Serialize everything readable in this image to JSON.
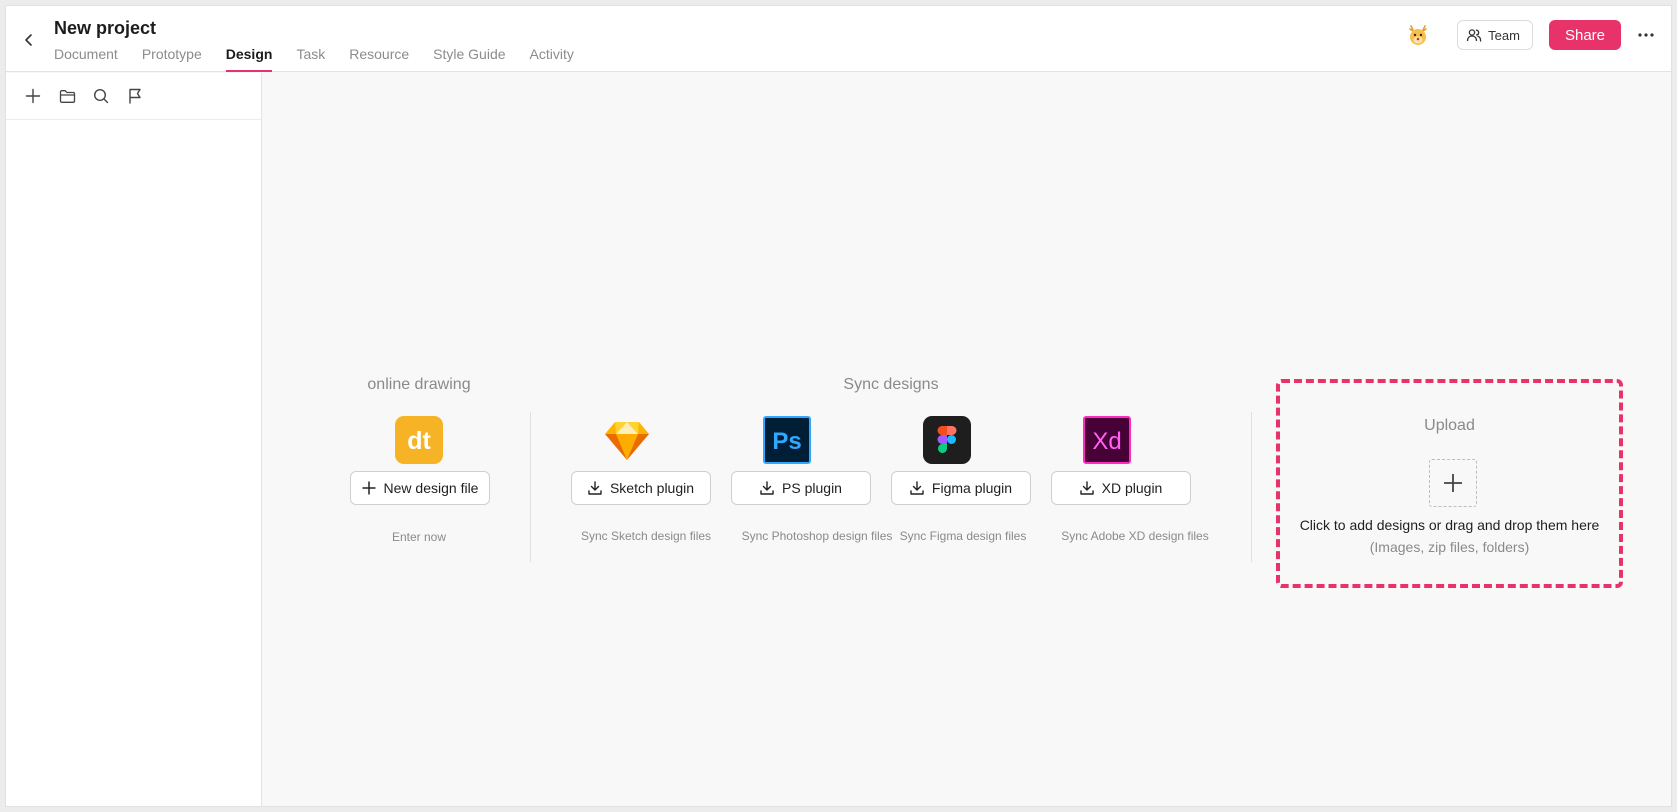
{
  "project": {
    "title": "New project"
  },
  "tabs": [
    {
      "label": "Document"
    },
    {
      "label": "Prototype"
    },
    {
      "label": "Design"
    },
    {
      "label": "Task"
    },
    {
      "label": "Resource"
    },
    {
      "label": "Style Guide"
    },
    {
      "label": "Activity"
    }
  ],
  "active_tab": "Design",
  "header": {
    "team_label": "Team",
    "share_label": "Share"
  },
  "sidebar": {
    "tools": [
      "add-icon",
      "folder-icon",
      "search-icon",
      "flag-icon"
    ]
  },
  "online_drawing": {
    "title": "online drawing",
    "button_label": "New design file",
    "caption": "Enter now"
  },
  "sync": {
    "title": "Sync designs",
    "items": [
      {
        "icon": "sketch-icon",
        "button_label": "Sketch plugin",
        "caption": "Sync Sketch design files"
      },
      {
        "icon": "photoshop-icon",
        "button_label": "PS plugin",
        "caption": "Sync Photoshop design files"
      },
      {
        "icon": "figma-icon",
        "button_label": "Figma plugin",
        "caption": "Sync Figma design files"
      },
      {
        "icon": "xd-icon",
        "button_label": "XD plugin",
        "caption": "Sync Adobe XD design files"
      }
    ]
  },
  "upload": {
    "title": "Upload",
    "text": "Click to add designs or drag and drop them here",
    "subtext": "(Images, zip files, folders)"
  },
  "colors": {
    "accent": "#e8336a",
    "brand_dt": "#f5b325",
    "ps": "#31a8ff",
    "xd": "#ff2bc2"
  }
}
